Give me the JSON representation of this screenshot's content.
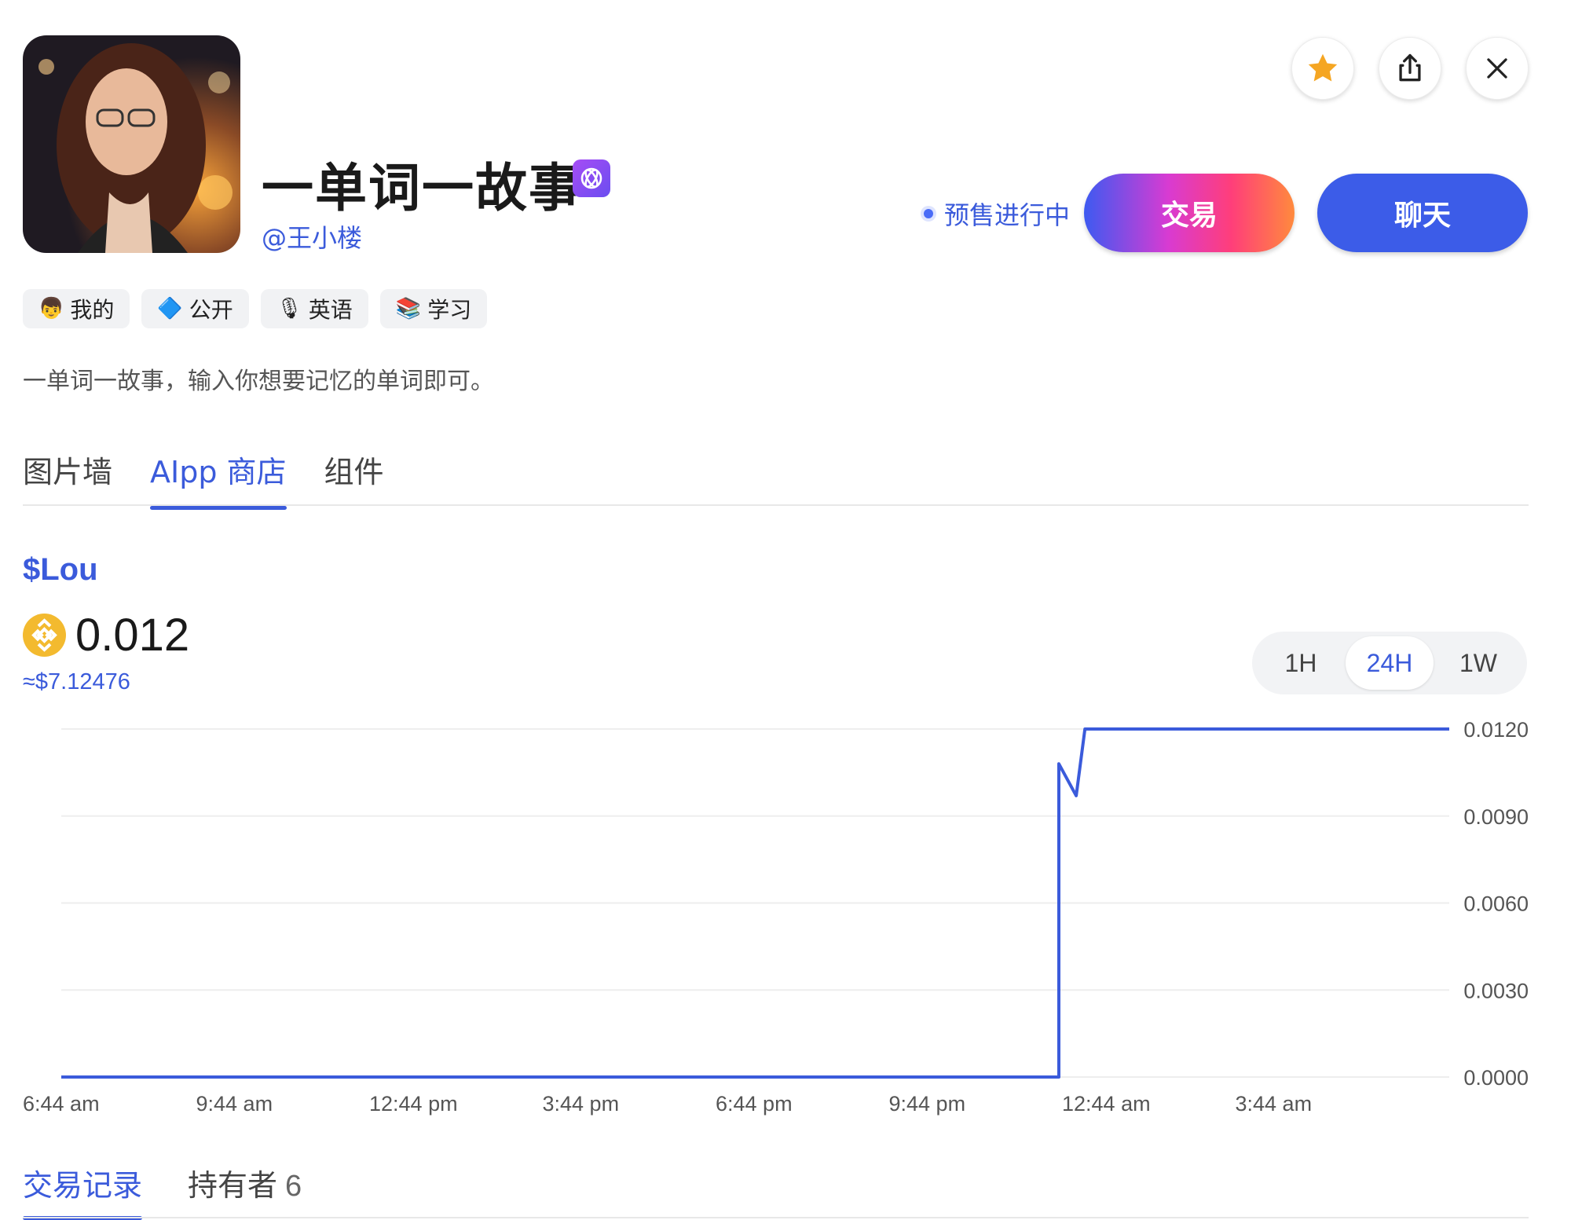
{
  "header": {
    "title": "一单词一故事",
    "handle": "@王小楼",
    "status": "预售进行中",
    "trade_label": "交易",
    "chat_label": "聊天",
    "icons": [
      "star-icon",
      "share-icon",
      "close-icon"
    ],
    "colors": {
      "accent": "#3b5bdb",
      "star": "#f5a623"
    }
  },
  "tags": [
    {
      "emoji": "👦",
      "label": "我的"
    },
    {
      "emoji": "🔷",
      "label": "公开"
    },
    {
      "emoji": "🎙",
      "label": "英语"
    },
    {
      "emoji": "📚",
      "label": "学习"
    }
  ],
  "description": "一单词一故事，输入你想要记忆的单词即可。",
  "tabs": [
    {
      "label": "图片墙",
      "active": false
    },
    {
      "label": "AIpp 商店",
      "active": true
    },
    {
      "label": "组件",
      "active": false
    }
  ],
  "token": {
    "ticker": "$Lou",
    "price": "0.012",
    "usd": "≈$7.12476"
  },
  "range": {
    "options": [
      "1H",
      "24H",
      "1W"
    ],
    "selected": "24H"
  },
  "chart_data": {
    "type": "line",
    "x_labels": [
      "6:44 am",
      "9:44 am",
      "12:44 pm",
      "3:44 pm",
      "6:44 pm",
      "9:44 pm",
      "12:44 am",
      "3:44 am"
    ],
    "y_ticks": [
      "0.0120",
      "0.0090",
      "0.0060",
      "0.0030",
      "0.0000"
    ],
    "ylim": [
      0,
      0.012
    ],
    "x_hours_span": 24,
    "series": [
      {
        "color": "#3b5bdb",
        "points": [
          [
            0,
            0.0
          ],
          [
            17.25,
            0.0
          ],
          [
            17.25,
            0.0108
          ],
          [
            17.55,
            0.0097
          ],
          [
            17.7,
            0.012
          ],
          [
            24,
            0.012
          ]
        ]
      }
    ],
    "grid": true
  },
  "bottom_tabs": [
    {
      "label": "交易记录",
      "count": "",
      "active": true
    },
    {
      "label": "持有者",
      "count": "6",
      "active": false
    }
  ]
}
